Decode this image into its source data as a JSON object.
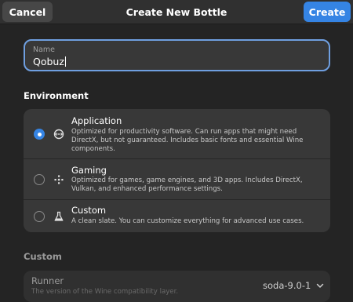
{
  "header": {
    "cancel_label": "Cancel",
    "title": "Create New Bottle",
    "create_label": "Create"
  },
  "name_field": {
    "label": "Name",
    "value": "Qobuz"
  },
  "environment": {
    "title": "Environment",
    "selected": "Application",
    "options": [
      {
        "icon": "application-icon",
        "label": "Application",
        "description": "Optimized for productivity software. Can run apps that might need DirectX, but not guaranteed. Includes basic fonts and essential Wine components."
      },
      {
        "icon": "gamepad-icon",
        "label": "Gaming",
        "description": "Optimized for games, game engines, and 3D apps. Includes DirectX, Vulkan, and enhanced performance settings."
      },
      {
        "icon": "flask-icon",
        "label": "Custom",
        "description": "A clean slate. You can customize everything for advanced use cases."
      }
    ]
  },
  "custom": {
    "title": "Custom",
    "runner_label": "Runner",
    "runner_subtitle": "The version of the Wine compatibility layer.",
    "runner_value": "soda-9.0-1"
  },
  "colors": {
    "accent": "#3584e4",
    "focus_ring": "#6f9fe0",
    "window_bg": "#242424",
    "card_bg": "#383838"
  }
}
